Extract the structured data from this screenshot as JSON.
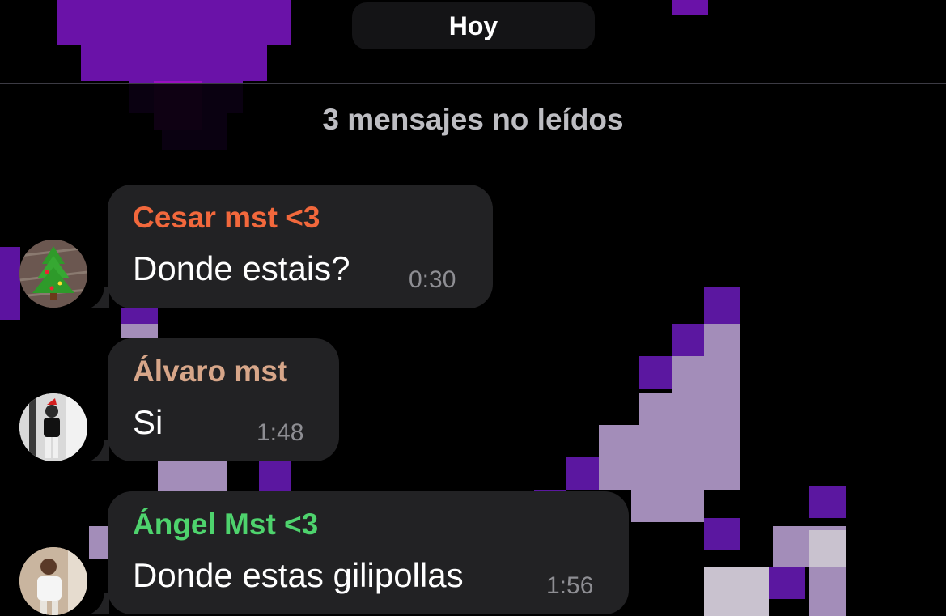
{
  "date_divider": {
    "label": "Hoy"
  },
  "unread_banner": {
    "label": "3 mensajes no leídos"
  },
  "messages": [
    {
      "sender": "Cesar mst <3",
      "text": "Donde estais?",
      "time": "0:30",
      "sender_color": "#f2683c",
      "avatar_icon": "christmas-tree-icon"
    },
    {
      "sender": "Álvaro mst",
      "text": "Si",
      "time": "1:48",
      "sender_color": "#d7a689",
      "avatar_icon": "person-photo-icon"
    },
    {
      "sender": "Ángel Mst <3",
      "text": "Donde estas gilipollas",
      "time": "1:56",
      "sender_color": "#4ed36d",
      "avatar_icon": "person-photo-icon"
    }
  ],
  "colors": {
    "bubble": "#222224",
    "wallpaper_purple": "#7a14b8",
    "wallpaper_lilac": "#9c86b0"
  }
}
